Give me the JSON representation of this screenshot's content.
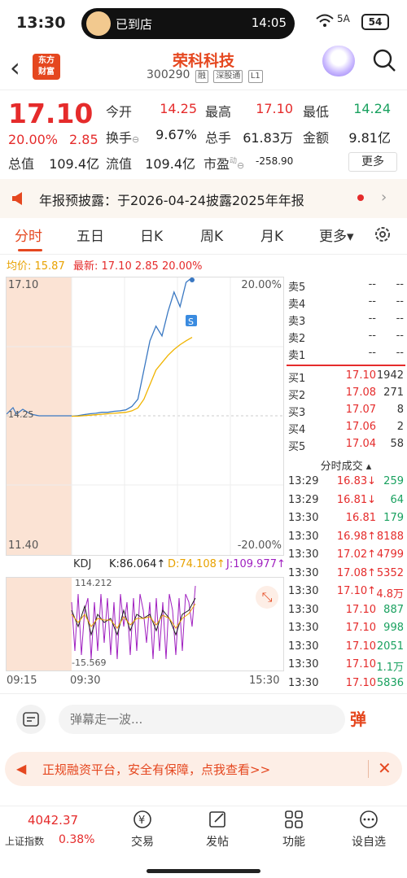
{
  "status": {
    "time": "13:30",
    "pill_text": "已到店",
    "pill_time": "14:05",
    "signal": "5A",
    "battery": "54"
  },
  "header": {
    "logo_line1": "东方",
    "logo_line2": "财富",
    "name": "荣科科技",
    "code": "300290",
    "tags": [
      "融",
      "深股通",
      "L1"
    ]
  },
  "quote": {
    "price": "17.10",
    "pct": "20.00%",
    "change": "2.85",
    "fields": [
      {
        "label": "今开",
        "value": "14.25",
        "color": "#e52b2b"
      },
      {
        "label": "最高",
        "value": "17.10",
        "color": "#e52b2b"
      },
      {
        "label": "最低",
        "value": "14.24",
        "color": "#19a15f"
      },
      {
        "label": "换手",
        "value": "9.67%",
        "color": "#222"
      },
      {
        "label": "总手",
        "value": "61.83万",
        "color": "#222"
      },
      {
        "label": "金额",
        "value": "9.81亿",
        "color": "#222"
      },
      {
        "label": "总值",
        "value": "109.4亿",
        "color": "#222"
      },
      {
        "label": "流值",
        "value": "109.4亿",
        "color": "#222"
      },
      {
        "label": "市盈",
        "value": "-258.90",
        "color": "#222"
      }
    ],
    "pe_sup": "动",
    "more": "更多"
  },
  "notice": {
    "text": "年报预披露：于2026-04-24披露2025年年报"
  },
  "tabs": [
    "分时",
    "五日",
    "日K",
    "周K",
    "月K",
    "更多▾"
  ],
  "chart_header": {
    "avg": "均价: 15.87",
    "latest": "最新: 17.10 2.85 20.00%"
  },
  "chart_data": {
    "type": "line",
    "y_left_max": "17.10",
    "y_left_min": "11.40",
    "y_mid": "14.25",
    "y_right_max": "20.00%",
    "y_right_min": "-20.00%",
    "x_labels": [
      "09:15",
      "09:30",
      "15:30"
    ],
    "series": [
      {
        "name": "",
        "values": [
          14.25,
          14.26,
          14.28,
          14.3,
          14.31,
          14.33,
          14.33,
          14.35,
          14.36,
          14.38,
          14.45,
          14.6,
          15.2,
          15.8,
          16.1,
          15.9,
          16.4,
          16.8,
          16.5,
          17.0,
          17.1
        ]
      },
      {
        "name": "均价",
        "values": [
          14.25,
          14.25,
          14.26,
          14.27,
          14.28,
          14.29,
          14.3,
          14.31,
          14.32,
          14.33,
          14.36,
          14.42,
          14.6,
          14.9,
          15.2,
          15.35,
          15.5,
          15.62,
          15.72,
          15.8,
          15.87
        ]
      }
    ]
  },
  "kdj": {
    "label": "KDJ",
    "k": "K:86.064↑",
    "d": "D:74.108↑",
    "j": "J:109.977↑",
    "top": "114.212",
    "bottom": "-15.569"
  },
  "orderbook": {
    "asks": [
      {
        "label": "卖5",
        "price": "--",
        "vol": "--"
      },
      {
        "label": "卖4",
        "price": "--",
        "vol": "--"
      },
      {
        "label": "卖3",
        "price": "--",
        "vol": "--"
      },
      {
        "label": "卖2",
        "price": "--",
        "vol": "--"
      },
      {
        "label": "卖1",
        "price": "--",
        "vol": "--"
      }
    ],
    "bids": [
      {
        "label": "买1",
        "price": "17.10",
        "vol": "1942"
      },
      {
        "label": "买2",
        "price": "17.08",
        "vol": "271"
      },
      {
        "label": "买3",
        "price": "17.07",
        "vol": "8"
      },
      {
        "label": "买4",
        "price": "17.06",
        "vol": "2"
      },
      {
        "label": "买5",
        "price": "17.04",
        "vol": "58"
      }
    ],
    "ticks_title": "分时成交 ▴",
    "ticks": [
      {
        "time": "13:29",
        "price": "16.83↓",
        "vol": "259",
        "pc": "#e52b2b",
        "vc": "#19a15f"
      },
      {
        "time": "13:29",
        "price": "16.81↓",
        "vol": "64",
        "pc": "#e52b2b",
        "vc": "#19a15f"
      },
      {
        "time": "13:30",
        "price": "16.81",
        "vol": "179",
        "pc": "#e52b2b",
        "vc": "#19a15f"
      },
      {
        "time": "13:30",
        "price": "16.98↑",
        "vol": "8188",
        "pc": "#e52b2b",
        "vc": "#e52b2b"
      },
      {
        "time": "13:30",
        "price": "17.02↑",
        "vol": "4799",
        "pc": "#e52b2b",
        "vc": "#e52b2b"
      },
      {
        "time": "13:30",
        "price": "17.08↑",
        "vol": "5352",
        "pc": "#e52b2b",
        "vc": "#e52b2b"
      },
      {
        "time": "13:30",
        "price": "17.10↑",
        "vol": "4.8万",
        "pc": "#e52b2b",
        "vc": "#e52b2b"
      },
      {
        "time": "13:30",
        "price": "17.10",
        "vol": "887",
        "pc": "#e52b2b",
        "vc": "#19a15f"
      },
      {
        "time": "13:30",
        "price": "17.10",
        "vol": "998",
        "pc": "#e52b2b",
        "vc": "#19a15f"
      },
      {
        "time": "13:30",
        "price": "17.10",
        "vol": "2051",
        "pc": "#e52b2b",
        "vc": "#19a15f"
      },
      {
        "time": "13:30",
        "price": "17.10",
        "vol": "1.1万",
        "pc": "#e52b2b",
        "vc": "#19a15f"
      },
      {
        "time": "13:30",
        "price": "17.10",
        "vol": "5836",
        "pc": "#e52b2b",
        "vc": "#19a15f"
      }
    ]
  },
  "danmu": {
    "placeholder": "弹幕走一波...",
    "button": "弹"
  },
  "ad": {
    "text": "正规融资平台，安全有保障，点我查看>>"
  },
  "bottom": {
    "index_value": "4042.37",
    "index_name": "上证指数",
    "index_pct": "0.38%",
    "nav": [
      "交易",
      "发帖",
      "功能",
      "设自选"
    ]
  }
}
